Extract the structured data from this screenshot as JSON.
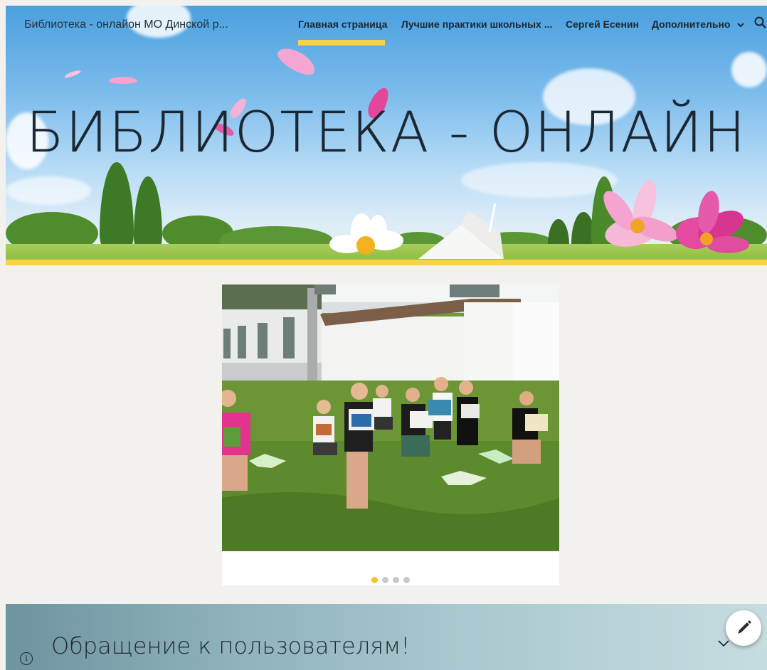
{
  "header": {
    "site_title": "Библиотека - онлайон МО Динской р...",
    "nav": [
      {
        "label": "Главная страница",
        "active": true
      },
      {
        "label": "Лучшие практики школьных ..."
      },
      {
        "label": "Сергей Есенин"
      },
      {
        "label": "Дополнительно"
      }
    ],
    "hero_title": "БИБЛИОТЕКА - ОНЛАЙН",
    "search_icon": "search-icon"
  },
  "carousel": {
    "slide_count": 4,
    "active_index": 0
  },
  "section": {
    "title": "Обращение к пользователям!",
    "info_icon": "info-icon",
    "info_glyph": "i",
    "expand_icon": "chevron-down-icon"
  },
  "fab": {
    "icon": "pencil-icon"
  },
  "colors": {
    "accent": "#f8d34a",
    "background": "#f3f1ee"
  }
}
